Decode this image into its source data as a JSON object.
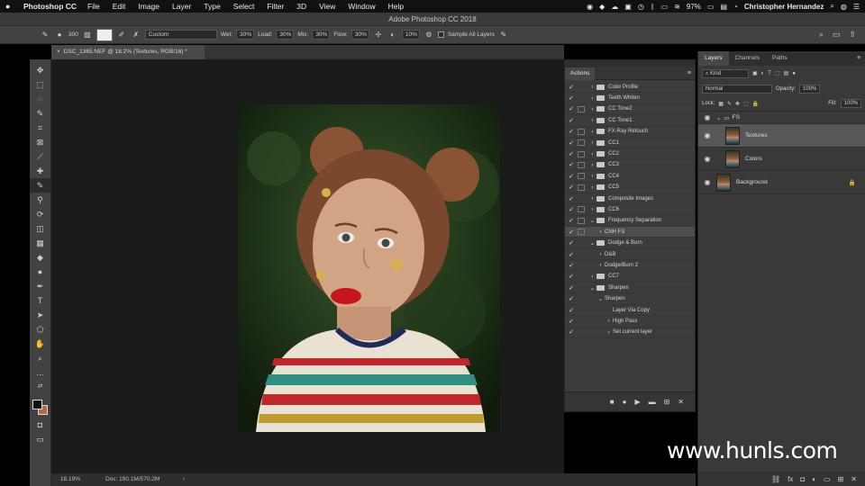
{
  "menubar": {
    "apple": "",
    "app_name": "Photoshop CC",
    "items": [
      "File",
      "Edit",
      "Image",
      "Layer",
      "Type",
      "Select",
      "Filter",
      "3D",
      "View",
      "Window",
      "Help"
    ],
    "battery": "97%",
    "user": "Christopher Hernandez"
  },
  "window_title": "Adobe Photoshop CC 2018",
  "options": {
    "brush_size": "300",
    "preset": "Custom",
    "wet_label": "Wet:",
    "wet": "30%",
    "load_label": "Load:",
    "load": "30%",
    "mix_label": "Mix:",
    "mix": "30%",
    "flow_label": "Flow:",
    "flow": "30%",
    "smoothing": "10%",
    "sample_all": "Sample All Layers"
  },
  "document": {
    "tab": "DSC_1365.NEF @ 18.2% (Textures, RGB/16) *",
    "zoom": "18.19%",
    "doc_size": "Doc: 190.1M/570.2M",
    "arrow": "›"
  },
  "actions_panel": {
    "title": "Actions",
    "rows": [
      {
        "label": "Color Profile",
        "depth": 0,
        "dlg": false,
        "open": false
      },
      {
        "label": "Teeth Whiten",
        "depth": 0,
        "dlg": false,
        "open": false
      },
      {
        "label": "CC Tone2",
        "depth": 0,
        "dlg": true,
        "open": false
      },
      {
        "label": "CC Tone1",
        "depth": 0,
        "dlg": false,
        "open": false
      },
      {
        "label": "FX-Ray Retouch",
        "depth": 0,
        "dlg": true,
        "open": false
      },
      {
        "label": "CC1",
        "depth": 0,
        "dlg": true,
        "open": false
      },
      {
        "label": "CC2",
        "depth": 0,
        "dlg": true,
        "open": false
      },
      {
        "label": "CC3",
        "depth": 0,
        "dlg": true,
        "open": false
      },
      {
        "label": "CC4",
        "depth": 0,
        "dlg": true,
        "open": false
      },
      {
        "label": "CC5",
        "depth": 0,
        "dlg": true,
        "open": false
      },
      {
        "label": "Composite Images",
        "depth": 0,
        "dlg": false,
        "open": false
      },
      {
        "label": "CC6",
        "depth": 0,
        "dlg": true,
        "open": false
      },
      {
        "label": "Frequency Separation",
        "depth": 0,
        "dlg": true,
        "open": true
      },
      {
        "label": "CNH FS",
        "depth": 1,
        "dlg": true,
        "open": false,
        "selected": true
      },
      {
        "label": "Dodge & Burn",
        "depth": 0,
        "dlg": false,
        "open": true
      },
      {
        "label": "D&B",
        "depth": 1,
        "dlg": false,
        "open": false
      },
      {
        "label": "Dodge/Burn 2",
        "depth": 1,
        "dlg": false,
        "open": false
      },
      {
        "label": "CC7",
        "depth": 0,
        "dlg": false,
        "open": false
      },
      {
        "label": "Sharpen",
        "depth": 0,
        "dlg": false,
        "open": true
      },
      {
        "label": "Sharpen",
        "depth": 1,
        "dlg": false,
        "open": true
      },
      {
        "label": "Layer Via Copy",
        "depth": 2,
        "dlg": false,
        "open": false,
        "leaf": true
      },
      {
        "label": "High Pass",
        "depth": 2,
        "dlg": false,
        "open": false
      },
      {
        "label": "Set current layer",
        "depth": 2,
        "dlg": false,
        "open": false
      }
    ],
    "bottom_icons": [
      "■",
      "●",
      "▶",
      "▬",
      "⊞",
      "🗑"
    ]
  },
  "layers_panel": {
    "tabs": [
      "Layers",
      "Channels",
      "Paths"
    ],
    "filter": "Kind",
    "blend_mode": "Normal",
    "opacity_label": "Opacity:",
    "opacity": "100%",
    "lock_label": "Lock:",
    "fill_label": "Fill:",
    "fill": "100%",
    "group": "FS",
    "layers": [
      {
        "name": "Textures",
        "selected": true,
        "indent": true
      },
      {
        "name": "Colors",
        "selected": false,
        "indent": true
      },
      {
        "name": "Background",
        "selected": false,
        "indent": false,
        "locked": true
      }
    ]
  },
  "watermark": "www.hunls.com"
}
